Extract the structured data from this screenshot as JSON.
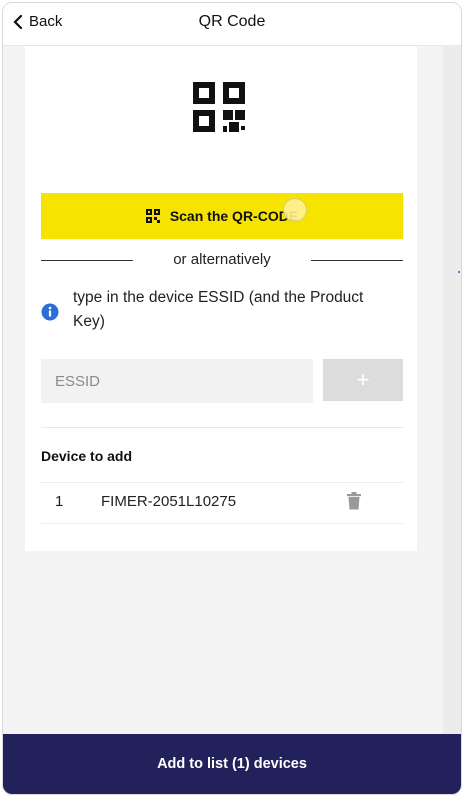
{
  "header": {
    "back_label": "Back",
    "title": "QR Code"
  },
  "scan": {
    "button_label": "Scan the QR-CODE"
  },
  "alternative": {
    "label": "or alternatively"
  },
  "info": {
    "text": "type in the device ESSID (and the Product Key)"
  },
  "essid": {
    "placeholder": "ESSID",
    "value": ""
  },
  "add_button": {
    "label": "+"
  },
  "devices": {
    "section_title": "Device to add",
    "rows": [
      {
        "index": "1",
        "name": "FIMER-2051L10275"
      }
    ]
  },
  "footer": {
    "button_label": "Add to list (1) devices"
  },
  "colors": {
    "accent_yellow": "#f6e400",
    "footer_navy": "#23215c",
    "info_blue": "#2b6fd6"
  },
  "icons": [
    "chevron-left-icon",
    "qr-code-icon",
    "info-icon",
    "trash-icon"
  ]
}
